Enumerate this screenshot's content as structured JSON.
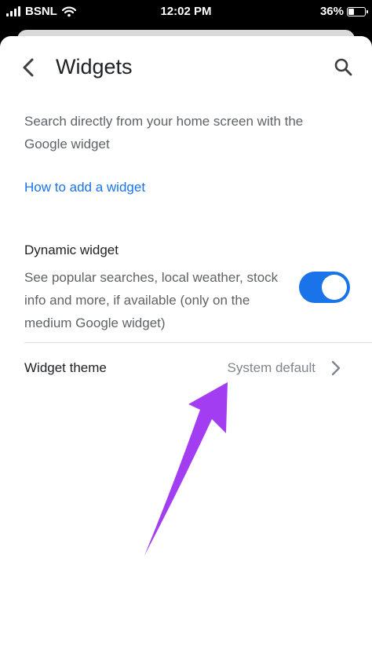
{
  "status_bar": {
    "carrier": "BSNL",
    "time": "12:02 PM",
    "battery": "36%",
    "battery_level": 0.36
  },
  "header": {
    "title": "Widgets",
    "back_icon": "chevron-left-icon",
    "search_icon": "search-icon"
  },
  "main": {
    "description": "Search directly from your home screen with the Google widget",
    "link": "How to add a widget",
    "dynamic_widget": {
      "title": "Dynamic widget",
      "description": "See popular searches, local weather, stock info and more, if available (only on the medium Google widget)",
      "enabled": true
    },
    "widget_theme": {
      "label": "Widget theme",
      "value": "System default",
      "chevron_icon": "chevron-right-icon"
    }
  },
  "annotation": {
    "arrow_color": "#a33df2"
  },
  "colors": {
    "accent": "#1a73e8",
    "primary_text": "#202124",
    "secondary_text": "#5f6368"
  }
}
